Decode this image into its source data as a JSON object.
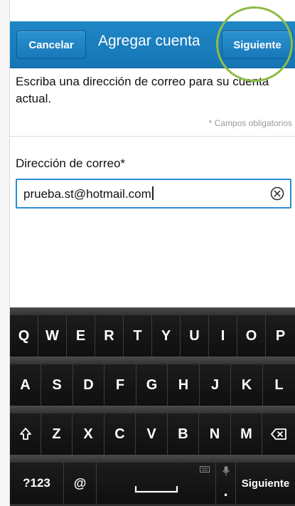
{
  "header": {
    "cancel_label": "Cancelar",
    "title": "Agregar cuenta",
    "next_label": "Siguiente"
  },
  "content": {
    "instructions": "Escriba una dirección de correo para su cuenta actual.",
    "required_note": "* Campos obligatorios",
    "email_label": "Dirección de correo*",
    "email_value": "prueba.st@hotmail.com"
  },
  "keyboard": {
    "row1": [
      "Q",
      "W",
      "E",
      "R",
      "T",
      "Y",
      "U",
      "I",
      "O",
      "P"
    ],
    "row2": [
      "A",
      "S",
      "D",
      "F",
      "G",
      "H",
      "J",
      "K",
      "L"
    ],
    "row3": [
      "Z",
      "X",
      "C",
      "V",
      "B",
      "N",
      "M"
    ],
    "symbols_label": "?123",
    "at_label": "@",
    "period_label": ".",
    "enter_label": "Siguiente"
  },
  "icons": {
    "clear": "clear-circle-x-icon",
    "shift": "shift-arrow-icon",
    "backspace": "backspace-icon",
    "space": "space-bar-icon",
    "keyboard_toggle": "keyboard-icon",
    "mic": "microphone-icon"
  },
  "colors": {
    "header_blue": "#1676b5",
    "field_border": "#2c8fd0",
    "annotation_ring": "#8fbc45",
    "keyboard_key": "#151515"
  }
}
